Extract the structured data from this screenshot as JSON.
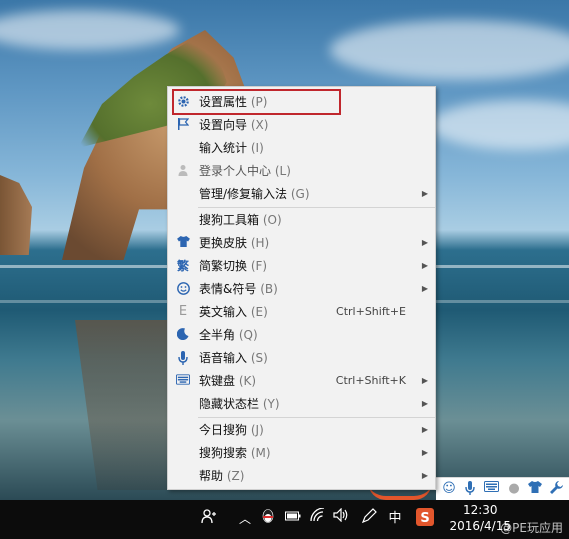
{
  "menu": {
    "items": [
      {
        "label": "设置属性",
        "accel": "(P)",
        "icon": "gear-icon",
        "submenu": false,
        "shortcut": ""
      },
      {
        "label": "设置向导",
        "accel": "(X)",
        "icon": "flag-icon",
        "submenu": false,
        "shortcut": ""
      },
      {
        "label": "输入统计",
        "accel": "(I)",
        "icon": "",
        "submenu": false,
        "shortcut": ""
      },
      {
        "label": "登录个人中心",
        "accel": "(L)",
        "icon": "user-icon",
        "submenu": false,
        "shortcut": ""
      },
      {
        "label": "管理/修复输入法",
        "accel": "(G)",
        "icon": "",
        "submenu": true,
        "shortcut": ""
      },
      {
        "label": "搜狗工具箱",
        "accel": "(O)",
        "icon": "",
        "submenu": false,
        "shortcut": ""
      },
      {
        "label": "更换皮肤",
        "accel": "(H)",
        "icon": "shirt-icon",
        "submenu": true,
        "shortcut": ""
      },
      {
        "label": "简繁切换",
        "accel": "(F)",
        "icon": "traditional-char-icon",
        "submenu": true,
        "shortcut": ""
      },
      {
        "label": "表情&符号",
        "accel": "(B)",
        "icon": "smiley-icon",
        "submenu": true,
        "shortcut": ""
      },
      {
        "label": "英文输入",
        "accel": "(E)",
        "icon": "english-e-icon",
        "submenu": false,
        "shortcut": "Ctrl+Shift+E"
      },
      {
        "label": "全半角",
        "accel": "(Q)",
        "icon": "moon-icon",
        "submenu": false,
        "shortcut": ""
      },
      {
        "label": "语音输入",
        "accel": "(S)",
        "icon": "microphone-icon",
        "submenu": false,
        "shortcut": ""
      },
      {
        "label": "软键盘",
        "accel": "(K)",
        "icon": "keyboard-icon",
        "submenu": true,
        "shortcut": "Ctrl+Shift+K"
      },
      {
        "label": "隐藏状态栏",
        "accel": "(Y)",
        "icon": "",
        "submenu": true,
        "shortcut": ""
      },
      {
        "label": "今日搜狗",
        "accel": "(J)",
        "icon": "",
        "submenu": true,
        "shortcut": ""
      },
      {
        "label": "搜狗搜索",
        "accel": "(M)",
        "icon": "",
        "submenu": true,
        "shortcut": ""
      },
      {
        "label": "帮助",
        "accel": "(Z)",
        "icon": "",
        "submenu": true,
        "shortcut": ""
      }
    ]
  },
  "taskbar": {
    "ime_mode": "中",
    "clock_time": "12:30",
    "clock_date": "2016/4/15",
    "watermark": "@PE玩应用"
  },
  "colors": {
    "highlight_border": "#c0272d",
    "icon_blue": "#2c65b1",
    "taskbar": "#0c0c0c",
    "menu_bg": "#f2f2f2"
  }
}
